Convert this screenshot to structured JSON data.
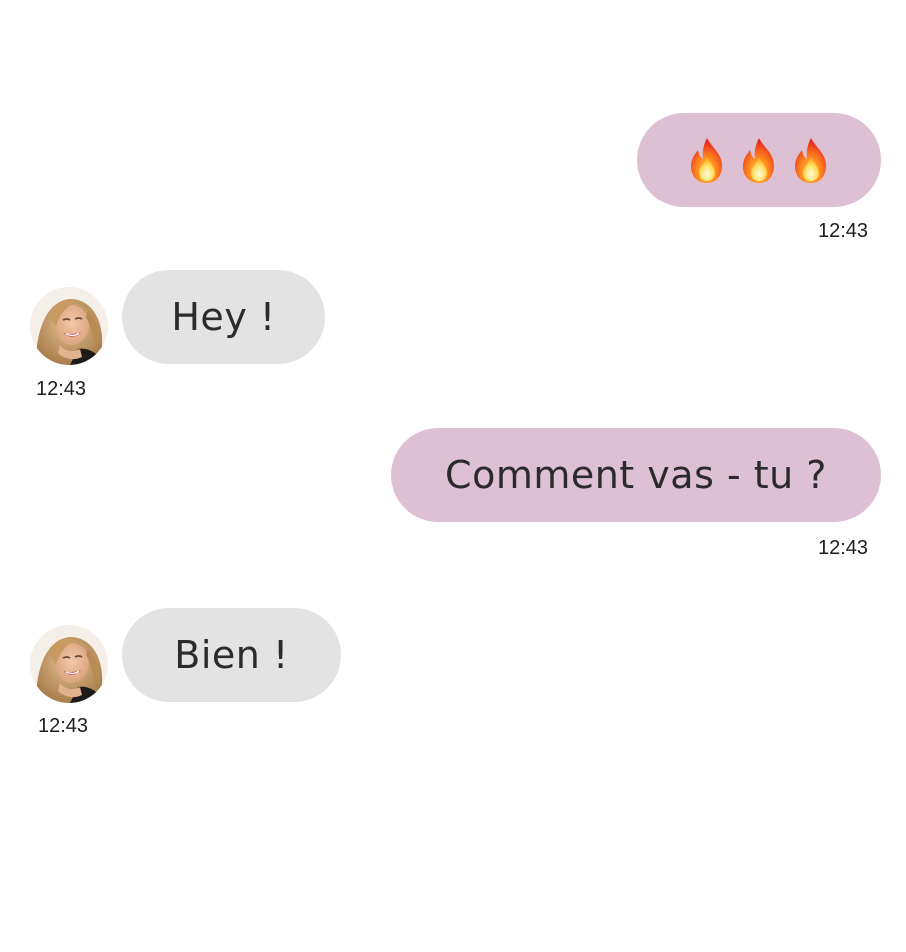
{
  "colors": {
    "sent_bubble": "#ddc0d4",
    "received_bubble": "#e3e3e3",
    "text": "#2b2b2b"
  },
  "messages": [
    {
      "side": "sent",
      "content": [
        "fire-icon",
        "fire-icon",
        "fire-icon"
      ],
      "time": "12:43"
    },
    {
      "side": "received",
      "text": "Hey !",
      "time": "12:43"
    },
    {
      "side": "sent",
      "text": "Comment vas - tu ?",
      "time": "12:43"
    },
    {
      "side": "received",
      "text": "Bien !",
      "time": "12:43"
    }
  ]
}
